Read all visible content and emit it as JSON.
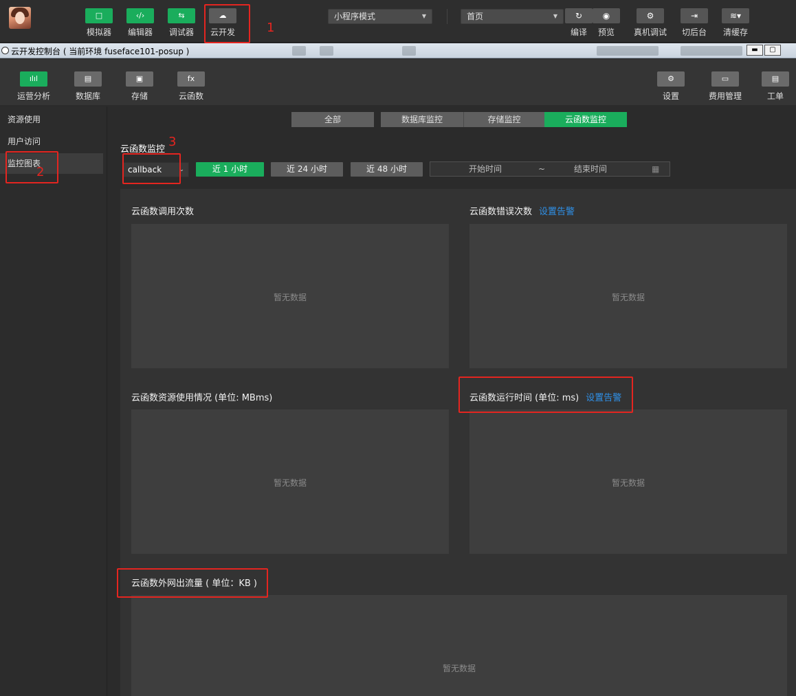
{
  "toolbar": {
    "buttons": [
      {
        "label": "模拟器",
        "icon": "□"
      },
      {
        "label": "编辑器",
        "icon": "‹/›"
      },
      {
        "label": "调试器",
        "icon": "⇆"
      },
      {
        "label": "云开发",
        "icon": "☁"
      }
    ],
    "mode_select": "小程序模式",
    "page_select": "首页",
    "right_buttons": [
      {
        "label": "编译",
        "icon": "↻"
      },
      {
        "label": "预览",
        "icon": "◉"
      },
      {
        "label": "真机调试",
        "icon": "⚙"
      },
      {
        "label": "切后台",
        "icon": "⇥"
      },
      {
        "label": "清缓存",
        "icon": "≋▾"
      }
    ]
  },
  "window": {
    "title": "云开发控制台 ( 当前环境 fuseface101-posup )",
    "controls": {
      "minimize": "▬",
      "maximize": "▢"
    }
  },
  "console_toolbar": {
    "left": [
      {
        "label": "运营分析",
        "icon": "ılıl"
      },
      {
        "label": "数据库",
        "icon": "▤"
      },
      {
        "label": "存储",
        "icon": "▣"
      },
      {
        "label": "云函数",
        "icon": "fx"
      }
    ],
    "right": [
      {
        "label": "设置",
        "icon": "⚙"
      },
      {
        "label": "费用管理",
        "icon": "▭"
      },
      {
        "label": "工单",
        "icon": "▤"
      }
    ]
  },
  "sidebar": {
    "items": [
      {
        "label": "资源使用"
      },
      {
        "label": "用户访问"
      },
      {
        "label": "监控图表"
      }
    ]
  },
  "tabs": [
    {
      "label": "全部"
    },
    {
      "label": "数据库监控"
    },
    {
      "label": "存储监控"
    },
    {
      "label": "云函数监控"
    }
  ],
  "filter": {
    "section_title": "云函数监控",
    "function_select": "callback",
    "ranges": [
      "近 1 小时",
      "近 24 小时",
      "近 48 小时"
    ],
    "start_placeholder": "开始时间",
    "separator": "~",
    "end_placeholder": "结束时间"
  },
  "charts": [
    {
      "title": "云函数调用次数",
      "link": "",
      "empty": "暂无数据"
    },
    {
      "title": "云函数错误次数",
      "link": "设置告警",
      "empty": "暂无数据"
    },
    {
      "title": "云函数资源使用情况 (单位: MBms)",
      "link": "",
      "empty": "暂无数据"
    },
    {
      "title": "云函数运行时间 (单位: ms)",
      "link": "设置告警",
      "empty": "暂无数据"
    },
    {
      "title": "云函数外网出流量 ( 单位：KB )",
      "link": "",
      "empty": "暂无数据"
    }
  ],
  "annotations": [
    "1",
    "2",
    "3"
  ]
}
